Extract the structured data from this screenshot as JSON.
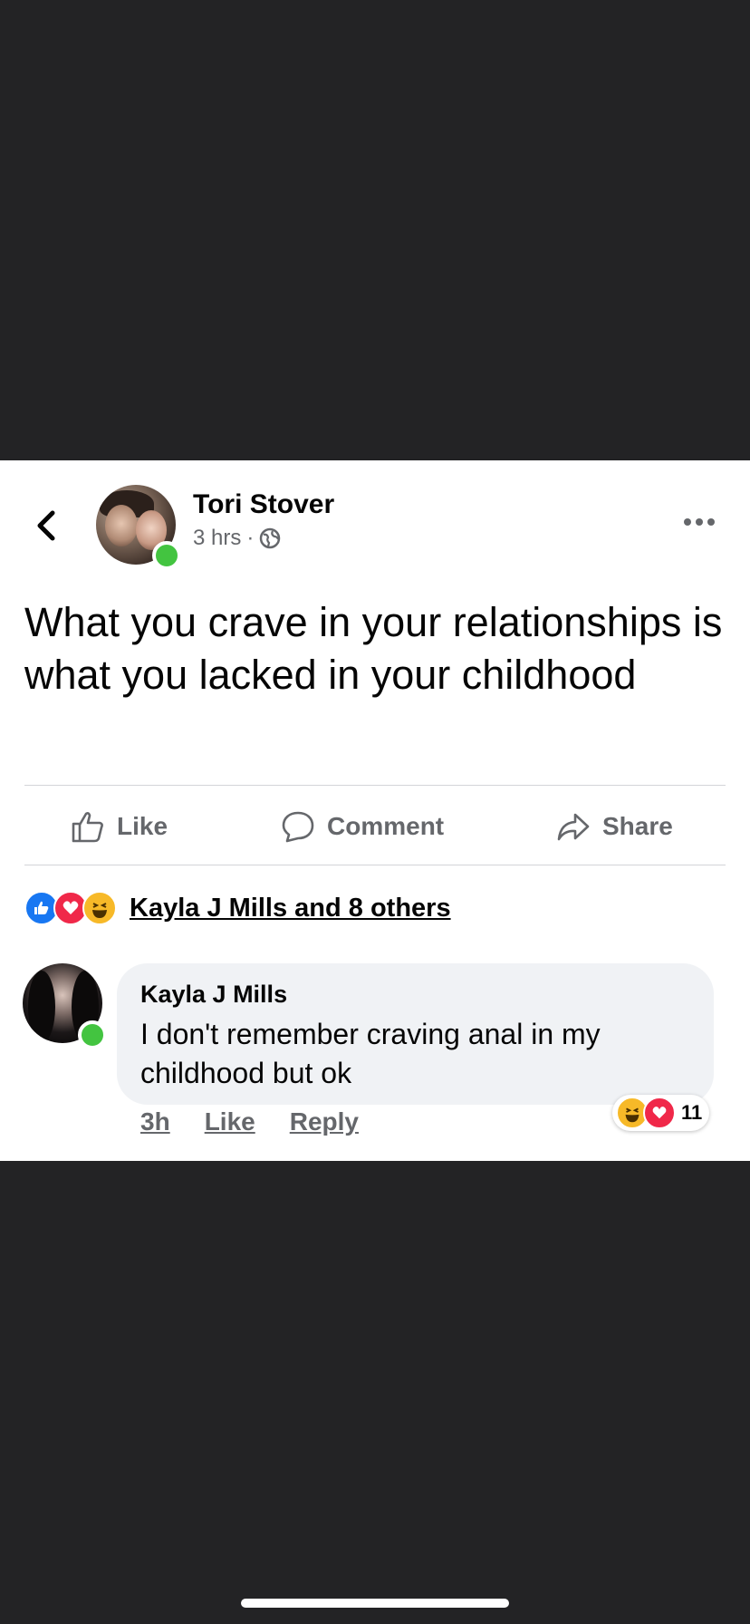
{
  "post": {
    "author": "Tori Stover",
    "time": "3 hrs",
    "separator": "·",
    "text": "What you crave in your relationships is what you lacked in your childhood"
  },
  "actions": {
    "like": "Like",
    "comment": "Comment",
    "share": "Share"
  },
  "reactions": {
    "summary": "Kayla J Mills and 8 others",
    "types": [
      "like",
      "love",
      "haha"
    ]
  },
  "comment": {
    "author": "Kayla J Mills",
    "text": "I don't remember craving anal in my childhood but ok",
    "time": "3h",
    "like": "Like",
    "reply": "Reply",
    "reaction_count": "11",
    "reaction_types": [
      "haha",
      "love"
    ]
  },
  "colors": {
    "background": "#232325",
    "card": "#ffffff",
    "like_blue": "#1877f2",
    "love_red": "#f02849",
    "haha_yellow": "#f7b928",
    "online_green": "#43c440",
    "secondary_text": "#65676b"
  }
}
